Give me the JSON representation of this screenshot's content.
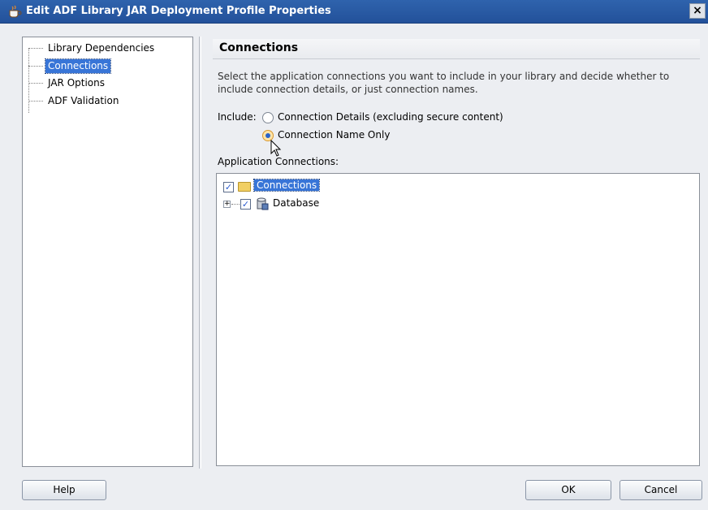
{
  "window": {
    "title": "Edit ADF Library JAR Deployment Profile Properties",
    "close_glyph": "×"
  },
  "nav": {
    "items": [
      {
        "label": "Library Dependencies",
        "selected": false
      },
      {
        "label": "Connections",
        "selected": true
      },
      {
        "label": "JAR Options",
        "selected": false
      },
      {
        "label": "ADF Validation",
        "selected": false
      }
    ]
  },
  "panel": {
    "title": "Connections",
    "description_line1": "Select the application connections you want to include in your library and decide whether to",
    "description_line2": "include connection details, or just connection names.",
    "include_label": "Include:",
    "options": [
      {
        "label": "Connection Details (excluding secure content)",
        "checked": false
      },
      {
        "label": "Connection Name Only",
        "checked": true
      }
    ],
    "app_connections_label": "Application Connections:"
  },
  "tree": {
    "root": {
      "label": "Connections",
      "checked": true
    },
    "children": [
      {
        "label": "Database",
        "checked": true,
        "expandable": true
      }
    ]
  },
  "buttons": {
    "help": "Help",
    "ok": "OK",
    "cancel": "Cancel"
  },
  "icons": {
    "app": "coffee-cup-icon",
    "close": "close-icon",
    "folder": "folder-icon",
    "database": "database-icon",
    "cursor": "mouse-pointer-icon"
  },
  "colors": {
    "titlebar": "#2f63ad",
    "selection": "#3875d7",
    "dialog_bg": "#eceef2"
  }
}
